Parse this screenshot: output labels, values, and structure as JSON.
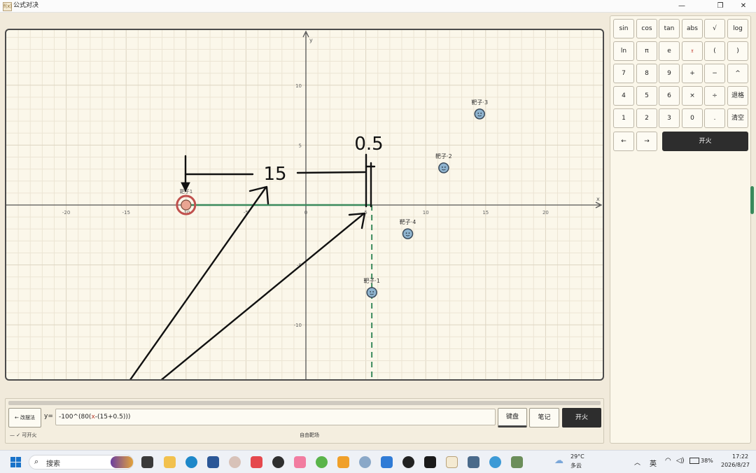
{
  "window": {
    "title": "公式对决",
    "icon_label": "f(x)"
  },
  "graph": {
    "x_axis_label": "x",
    "y_axis_label": "y",
    "x_ticks": [
      "-20",
      "-15",
      "-10",
      "-5",
      "0",
      "5",
      "10",
      "15",
      "20"
    ],
    "y_ticks": [
      "10",
      "5",
      "-5",
      "-10"
    ],
    "player_label": "靶子1",
    "targets": [
      {
        "label": "靶子·1",
        "x": 5.5,
        "y": -7.3
      },
      {
        "label": "靶子·2",
        "x": 11.5,
        "y": 3.1
      },
      {
        "label": "靶子·3",
        "x": 14.5,
        "y": 7.6
      },
      {
        "label": "靶子·4",
        "x": 8.5,
        "y": -2.4
      }
    ],
    "player": {
      "x": -10,
      "y": 0
    },
    "vertical_line_x": 5.5,
    "annotations": {
      "distance": "15",
      "offset": "0.5"
    },
    "colors": {
      "curve": "#3a8a5c",
      "player": "#c0504d",
      "target": "#8fb4cf"
    }
  },
  "keypad": {
    "rows": [
      [
        "sin",
        "cos",
        "tan",
        "abs",
        "√",
        "log"
      ],
      [
        "ln",
        "π",
        "e",
        "𝔵",
        "(",
        ")"
      ],
      [
        "7",
        "8",
        "9",
        "+",
        "−",
        "^"
      ],
      [
        "4",
        "5",
        "6",
        "×",
        "÷",
        "退格"
      ],
      [
        "1",
        "2",
        "3",
        "0",
        ".",
        "清空"
      ]
    ],
    "nav_left": "←",
    "nav_right": "→",
    "fire": "开火"
  },
  "input": {
    "back_button": "← 改摆法",
    "formula_prefix": "y=",
    "formula_pre": "-100^(80(",
    "formula_var": "x",
    "formula_post": "-(15+0.5)))",
    "keyboard_button": "键盘",
    "notes_button": "笔记",
    "fire_button": "开火",
    "status": "— ✓ 可开火",
    "mode": "自由靶场"
  },
  "taskbar": {
    "search_label": "搜索",
    "weather_temp": "29°C",
    "weather_desc": "多云",
    "ime": "英",
    "battery": "38%",
    "time": "17:22",
    "date": "2026/8/27"
  }
}
